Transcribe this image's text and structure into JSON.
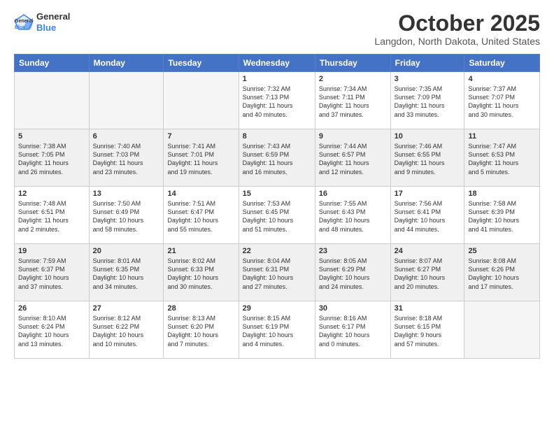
{
  "header": {
    "logo_line1": "General",
    "logo_line2": "Blue",
    "month": "October 2025",
    "location": "Langdon, North Dakota, United States"
  },
  "days_of_week": [
    "Sunday",
    "Monday",
    "Tuesday",
    "Wednesday",
    "Thursday",
    "Friday",
    "Saturday"
  ],
  "weeks": [
    [
      {
        "num": "",
        "info": ""
      },
      {
        "num": "",
        "info": ""
      },
      {
        "num": "",
        "info": ""
      },
      {
        "num": "1",
        "info": "Sunrise: 7:32 AM\nSunset: 7:13 PM\nDaylight: 11 hours\nand 40 minutes."
      },
      {
        "num": "2",
        "info": "Sunrise: 7:34 AM\nSunset: 7:11 PM\nDaylight: 11 hours\nand 37 minutes."
      },
      {
        "num": "3",
        "info": "Sunrise: 7:35 AM\nSunset: 7:09 PM\nDaylight: 11 hours\nand 33 minutes."
      },
      {
        "num": "4",
        "info": "Sunrise: 7:37 AM\nSunset: 7:07 PM\nDaylight: 11 hours\nand 30 minutes."
      }
    ],
    [
      {
        "num": "5",
        "info": "Sunrise: 7:38 AM\nSunset: 7:05 PM\nDaylight: 11 hours\nand 26 minutes."
      },
      {
        "num": "6",
        "info": "Sunrise: 7:40 AM\nSunset: 7:03 PM\nDaylight: 11 hours\nand 23 minutes."
      },
      {
        "num": "7",
        "info": "Sunrise: 7:41 AM\nSunset: 7:01 PM\nDaylight: 11 hours\nand 19 minutes."
      },
      {
        "num": "8",
        "info": "Sunrise: 7:43 AM\nSunset: 6:59 PM\nDaylight: 11 hours\nand 16 minutes."
      },
      {
        "num": "9",
        "info": "Sunrise: 7:44 AM\nSunset: 6:57 PM\nDaylight: 11 hours\nand 12 minutes."
      },
      {
        "num": "10",
        "info": "Sunrise: 7:46 AM\nSunset: 6:55 PM\nDaylight: 11 hours\nand 9 minutes."
      },
      {
        "num": "11",
        "info": "Sunrise: 7:47 AM\nSunset: 6:53 PM\nDaylight: 11 hours\nand 5 minutes."
      }
    ],
    [
      {
        "num": "12",
        "info": "Sunrise: 7:48 AM\nSunset: 6:51 PM\nDaylight: 11 hours\nand 2 minutes."
      },
      {
        "num": "13",
        "info": "Sunrise: 7:50 AM\nSunset: 6:49 PM\nDaylight: 10 hours\nand 58 minutes."
      },
      {
        "num": "14",
        "info": "Sunrise: 7:51 AM\nSunset: 6:47 PM\nDaylight: 10 hours\nand 55 minutes."
      },
      {
        "num": "15",
        "info": "Sunrise: 7:53 AM\nSunset: 6:45 PM\nDaylight: 10 hours\nand 51 minutes."
      },
      {
        "num": "16",
        "info": "Sunrise: 7:55 AM\nSunset: 6:43 PM\nDaylight: 10 hours\nand 48 minutes."
      },
      {
        "num": "17",
        "info": "Sunrise: 7:56 AM\nSunset: 6:41 PM\nDaylight: 10 hours\nand 44 minutes."
      },
      {
        "num": "18",
        "info": "Sunrise: 7:58 AM\nSunset: 6:39 PM\nDaylight: 10 hours\nand 41 minutes."
      }
    ],
    [
      {
        "num": "19",
        "info": "Sunrise: 7:59 AM\nSunset: 6:37 PM\nDaylight: 10 hours\nand 37 minutes."
      },
      {
        "num": "20",
        "info": "Sunrise: 8:01 AM\nSunset: 6:35 PM\nDaylight: 10 hours\nand 34 minutes."
      },
      {
        "num": "21",
        "info": "Sunrise: 8:02 AM\nSunset: 6:33 PM\nDaylight: 10 hours\nand 30 minutes."
      },
      {
        "num": "22",
        "info": "Sunrise: 8:04 AM\nSunset: 6:31 PM\nDaylight: 10 hours\nand 27 minutes."
      },
      {
        "num": "23",
        "info": "Sunrise: 8:05 AM\nSunset: 6:29 PM\nDaylight: 10 hours\nand 24 minutes."
      },
      {
        "num": "24",
        "info": "Sunrise: 8:07 AM\nSunset: 6:27 PM\nDaylight: 10 hours\nand 20 minutes."
      },
      {
        "num": "25",
        "info": "Sunrise: 8:08 AM\nSunset: 6:26 PM\nDaylight: 10 hours\nand 17 minutes."
      }
    ],
    [
      {
        "num": "26",
        "info": "Sunrise: 8:10 AM\nSunset: 6:24 PM\nDaylight: 10 hours\nand 13 minutes."
      },
      {
        "num": "27",
        "info": "Sunrise: 8:12 AM\nSunset: 6:22 PM\nDaylight: 10 hours\nand 10 minutes."
      },
      {
        "num": "28",
        "info": "Sunrise: 8:13 AM\nSunset: 6:20 PM\nDaylight: 10 hours\nand 7 minutes."
      },
      {
        "num": "29",
        "info": "Sunrise: 8:15 AM\nSunset: 6:19 PM\nDaylight: 10 hours\nand 4 minutes."
      },
      {
        "num": "30",
        "info": "Sunrise: 8:16 AM\nSunset: 6:17 PM\nDaylight: 10 hours\nand 0 minutes."
      },
      {
        "num": "31",
        "info": "Sunrise: 8:18 AM\nSunset: 6:15 PM\nDaylight: 9 hours\nand 57 minutes."
      },
      {
        "num": "",
        "info": ""
      }
    ]
  ]
}
